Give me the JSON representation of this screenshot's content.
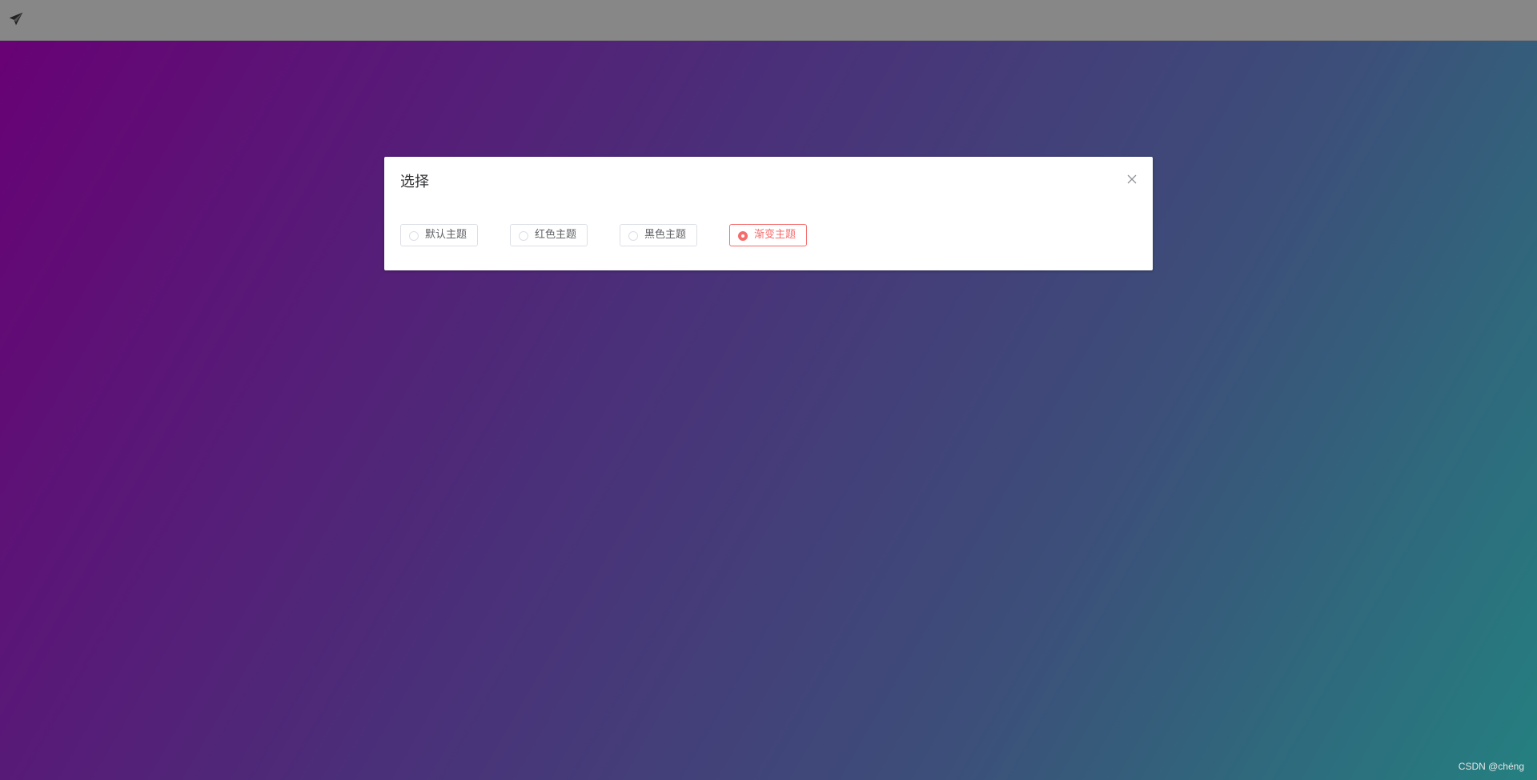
{
  "dialog": {
    "title": "选择",
    "options": [
      {
        "label": "默认主题",
        "checked": false
      },
      {
        "label": "红色主题",
        "checked": false
      },
      {
        "label": "黑色主题",
        "checked": false
      },
      {
        "label": "渐变主题",
        "checked": true
      }
    ]
  },
  "watermark": "CSDN @chéng",
  "icons": {
    "logo": "paper-plane-icon",
    "close": "close-icon"
  },
  "colors": {
    "accent": "#f56c6c",
    "topbar": "#878787",
    "gradient_start": "#690075",
    "gradient_end": "#248080"
  }
}
